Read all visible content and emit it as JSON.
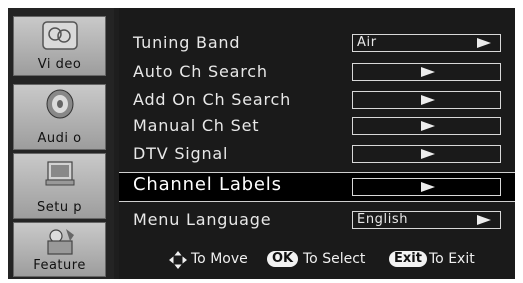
{
  "sidebar": {
    "items": [
      {
        "label": "Vi deo",
        "icon": "video-icon"
      },
      {
        "label": "Audi o",
        "icon": "audio-speaker-icon"
      },
      {
        "label": "Setu p",
        "icon": "setup-icon"
      },
      {
        "label": "Feature",
        "icon": "feature-icon"
      }
    ]
  },
  "menu": {
    "rows": [
      {
        "label": "Tuning Band",
        "value": "Air"
      },
      {
        "label": "Auto Ch Search",
        "value": ""
      },
      {
        "label": "Add On Ch Search",
        "value": ""
      },
      {
        "label": "Manual Ch Set",
        "value": ""
      },
      {
        "label": "DTV Signal",
        "value": ""
      },
      {
        "label": "Channel Labels",
        "value": "",
        "selected": true
      },
      {
        "label": "Menu Language",
        "value": "English"
      }
    ]
  },
  "footer": {
    "move_icon": "four-way-arrow-icon",
    "to_move": "To Move",
    "ok_key": "OK",
    "to_select": "To Select",
    "exit_key": "Exit",
    "to_exit": "To Exit"
  },
  "colors": {
    "panel": "#1a1a1a",
    "sidebar_tab": "#b3b3b3",
    "text": "#e8e8e8"
  }
}
